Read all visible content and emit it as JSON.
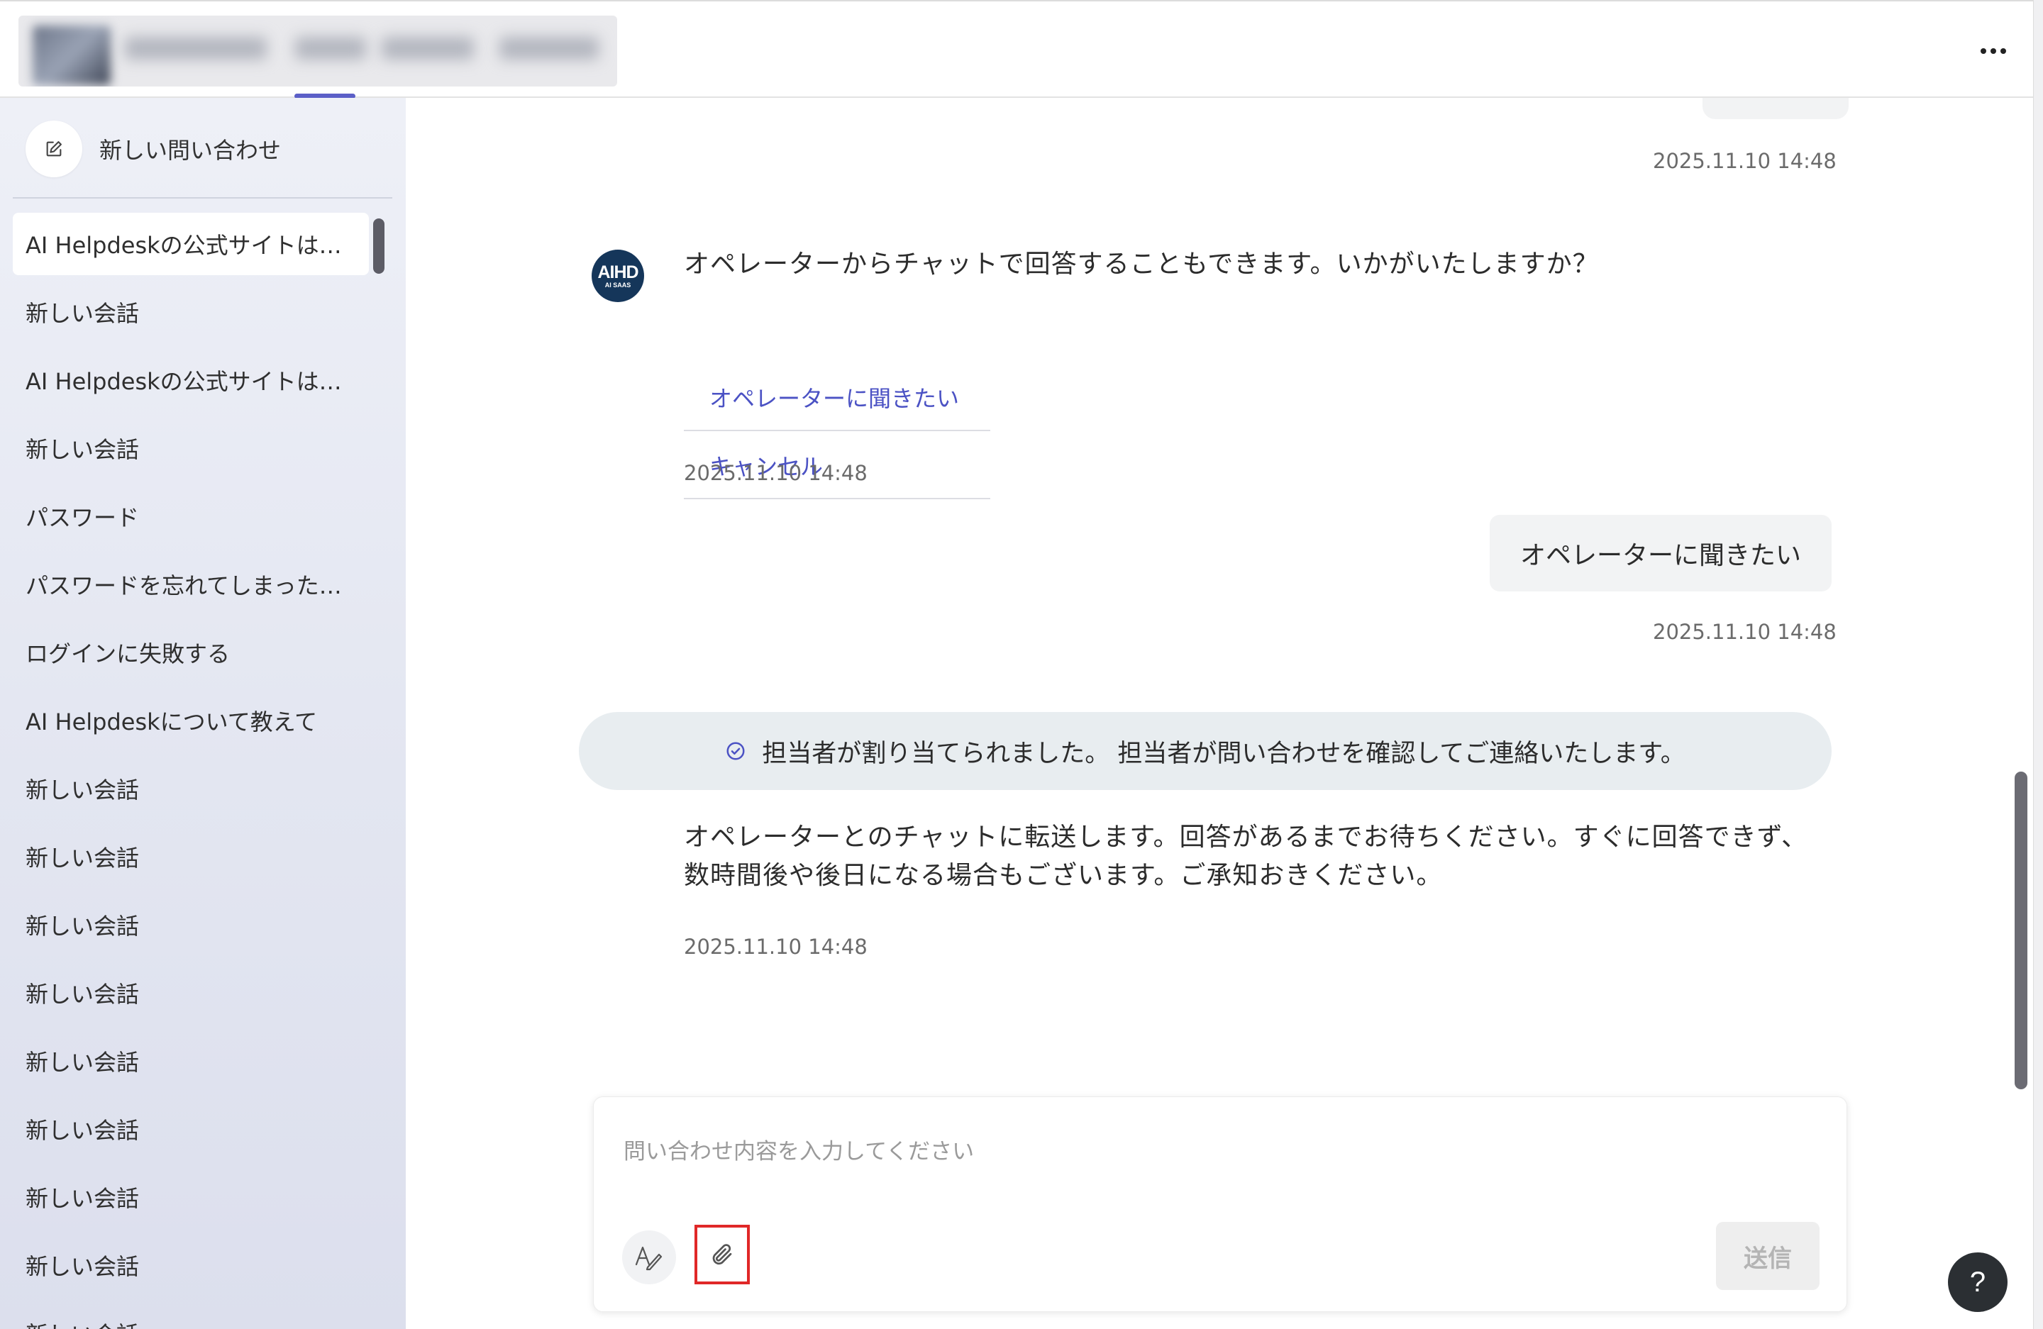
{
  "header": {
    "more_icon": "more-horizontal-icon"
  },
  "sidebar": {
    "new_inquiry_label": "新しい問い合わせ",
    "new_inquiry_icon": "edit-square-icon",
    "conversations": [
      {
        "label": "AI Helpdeskの公式サイトは…",
        "active": true
      },
      {
        "label": "新しい会話"
      },
      {
        "label": "AI Helpdeskの公式サイトは…"
      },
      {
        "label": "新しい会話"
      },
      {
        "label": "パスワード"
      },
      {
        "label": "パスワードを忘れてしまった…"
      },
      {
        "label": "ログインに失敗する"
      },
      {
        "label": "AI Helpdeskについて教えて"
      },
      {
        "label": "新しい会話"
      },
      {
        "label": "新しい会話"
      },
      {
        "label": "新しい会話"
      },
      {
        "label": "新しい会話"
      },
      {
        "label": "新しい会話"
      },
      {
        "label": "新しい会話"
      },
      {
        "label": "新しい会話"
      },
      {
        "label": "新しい会話"
      },
      {
        "label": "新しい会話"
      }
    ]
  },
  "chat": {
    "timestamp_top": "2025.11.10 14:48",
    "bot_avatar": {
      "big": "AIHD",
      "small": "AI SAAS"
    },
    "bot_message_1": "オペレーターからチャットで回答することもできます。いかがいたしますか？",
    "options": [
      "オペレーターに聞きたい",
      "キャンセル"
    ],
    "timestamp_bot_1": "2025.11.10 14:48",
    "user_message": "オペレーターに聞きたい",
    "timestamp_user": "2025.11.10 14:48",
    "assignment_notice": "担当者が割り当てられました。 担当者が問い合わせを確認してご連絡いたします。",
    "bot_message_2_line1": "オペレーターとのチャットに転送します。回答があるまでお待ちください。すぐに回答できず、",
    "bot_message_2_line2": "数時間後や後日になる場合もございます。ご承知おきください。",
    "timestamp_bot_2": "2025.11.10 14:48"
  },
  "composer": {
    "placeholder": "問い合わせ内容を入力してください",
    "format_icon": "text-format-icon",
    "attach_icon": "paperclip-icon",
    "send_label": "送信"
  },
  "help": {
    "label": "?"
  },
  "colors": {
    "accent": "#5b5fc7",
    "link": "#4b52c4",
    "highlight_border": "#e02828"
  }
}
